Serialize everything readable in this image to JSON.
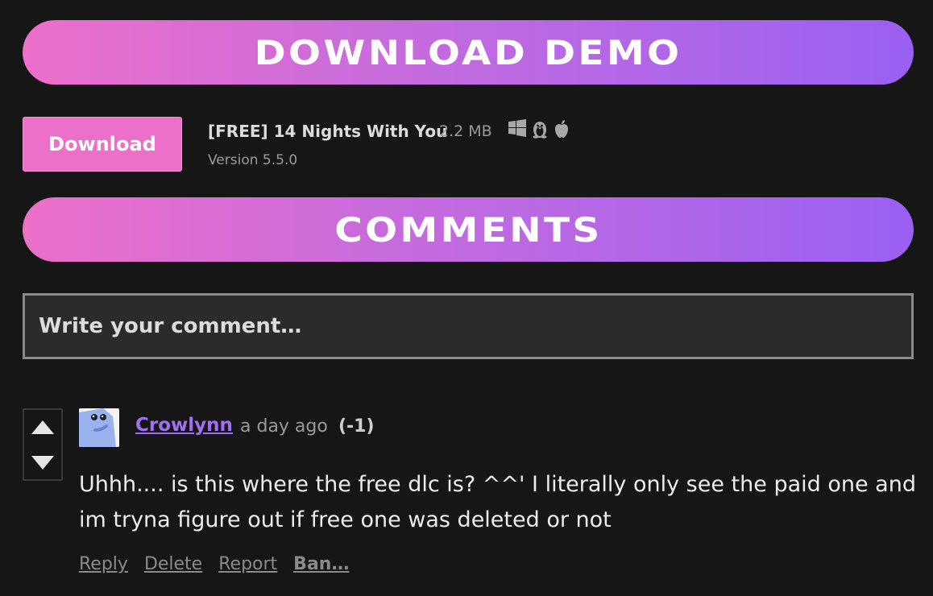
{
  "banners": {
    "download": "DOWNLOAD DEMO",
    "comments": "COMMENTS"
  },
  "download": {
    "button_label": "Download",
    "file_name": "[FREE] 14 Nights With You",
    "file_size": "2.2 MB",
    "version": "Version 5.5.0",
    "platform_icons": [
      "windows-icon",
      "linux-icon",
      "apple-icon"
    ]
  },
  "comment_input": {
    "placeholder": "Write your comment…"
  },
  "comment": {
    "user": "Crowlynn",
    "time": "a day ago",
    "score": "(-1)",
    "body": "Uhhh.... is this where the free dlc is? ^^' I literally only see the paid one and im tryna figure out if free one was deleted or not",
    "actions": {
      "reply": "Reply",
      "delete": "Delete",
      "report": "Report",
      "ban": "Ban…"
    }
  },
  "colors": {
    "background": "#161616",
    "gradient_start": "#ec6fc9",
    "gradient_end": "#9a60f2",
    "download_button": "#ec6fc9",
    "username": "#a16ef6"
  }
}
